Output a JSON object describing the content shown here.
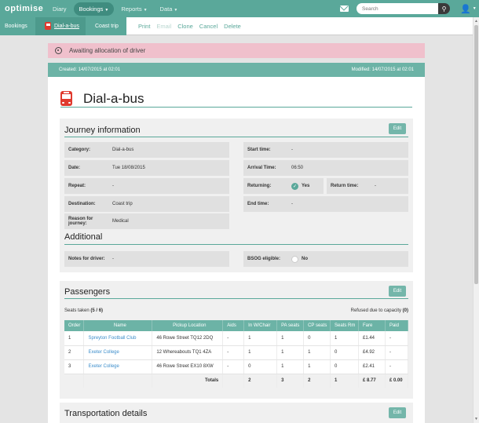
{
  "nav": {
    "logo": "optimise",
    "items": [
      {
        "label": "Diary",
        "active": false,
        "dropdown": false
      },
      {
        "label": "Bookings",
        "active": true,
        "dropdown": true
      },
      {
        "label": "Reports",
        "active": false,
        "dropdown": true
      },
      {
        "label": "Data",
        "active": false,
        "dropdown": true
      }
    ],
    "search_placeholder": "Search",
    "icons": [
      "mail-icon",
      "search-icon",
      "user-icon"
    ]
  },
  "breadcrumb": {
    "items": [
      "Bookings",
      "Dial-a-bus",
      "Coast trip"
    ],
    "actions": [
      {
        "label": "Print",
        "enabled": true
      },
      {
        "label": "Email",
        "enabled": false
      },
      {
        "label": "Clone",
        "enabled": true
      },
      {
        "label": "Cancel",
        "enabled": true
      },
      {
        "label": "Delete",
        "enabled": true
      }
    ]
  },
  "alert": {
    "text": "Awaiting allocation of driver",
    "color": "#f0c0cc"
  },
  "meta": {
    "created": "Created: 14/07/2015 at 02:01",
    "modified": "Modified: 14/07/2015 at 02:01"
  },
  "booking": {
    "title": "Dial-a-bus"
  },
  "journey": {
    "heading": "Journey information",
    "edit": "Edit",
    "category": {
      "label": "Category:",
      "value": "Dial-a-bus"
    },
    "date": {
      "label": "Date:",
      "value": "Tue 18/08/2015"
    },
    "repeat": {
      "label": "Repeat:",
      "value": "-"
    },
    "destination": {
      "label": "Destination:",
      "value": "Coast trip"
    },
    "reason": {
      "label": "Reason for journey:",
      "value": "Medical"
    },
    "start_time": {
      "label": "Start time:",
      "value": "-"
    },
    "arrival_time": {
      "label": "Arrival Time:",
      "value": "06:50"
    },
    "returning": {
      "label": "Returning:",
      "value": "Yes"
    },
    "return_time": {
      "label": "Return time:",
      "value": "-"
    },
    "end_time": {
      "label": "End time:",
      "value": "-"
    }
  },
  "additional": {
    "heading": "Additional",
    "notes": {
      "label": "Notes for driver:",
      "value": "-"
    },
    "bsog": {
      "label": "BSOG eligible:",
      "value": "No"
    }
  },
  "passengers": {
    "heading": "Passengers",
    "edit": "Edit",
    "seats_prefix": "Seats taken",
    "seats_value": "(5 / 6)",
    "refused_prefix": "Refused due to capacity",
    "refused_value": "(0)",
    "columns": [
      "Order",
      "Name",
      "Pickup Location",
      "Aids",
      "In W/Chair",
      "PA seats",
      "CP seats",
      "Seats Rm",
      "Fare",
      "Paid"
    ],
    "rows": [
      [
        "1",
        "Spreyton Football Club",
        "46 Rowe Street TQ12 2DQ",
        "-",
        "1",
        "1",
        "0",
        "1",
        "£1.44",
        "-"
      ],
      [
        "2",
        "Exeter College",
        "12 Whereabouts TQ1 4ZA",
        "-",
        "1",
        "1",
        "1",
        "0",
        "£4.92",
        "-"
      ],
      [
        "3",
        "Exeter College",
        "46 Rowe Street EX10 8XW",
        "-",
        "0",
        "1",
        "1",
        "0",
        "£2.41",
        "-"
      ]
    ],
    "totals_label": "Totals",
    "totals": [
      "2",
      "3",
      "2",
      "1",
      "£ 8.77",
      "£ 0.00"
    ]
  },
  "transport": {
    "heading": "Transportation details",
    "edit": "Edit"
  }
}
